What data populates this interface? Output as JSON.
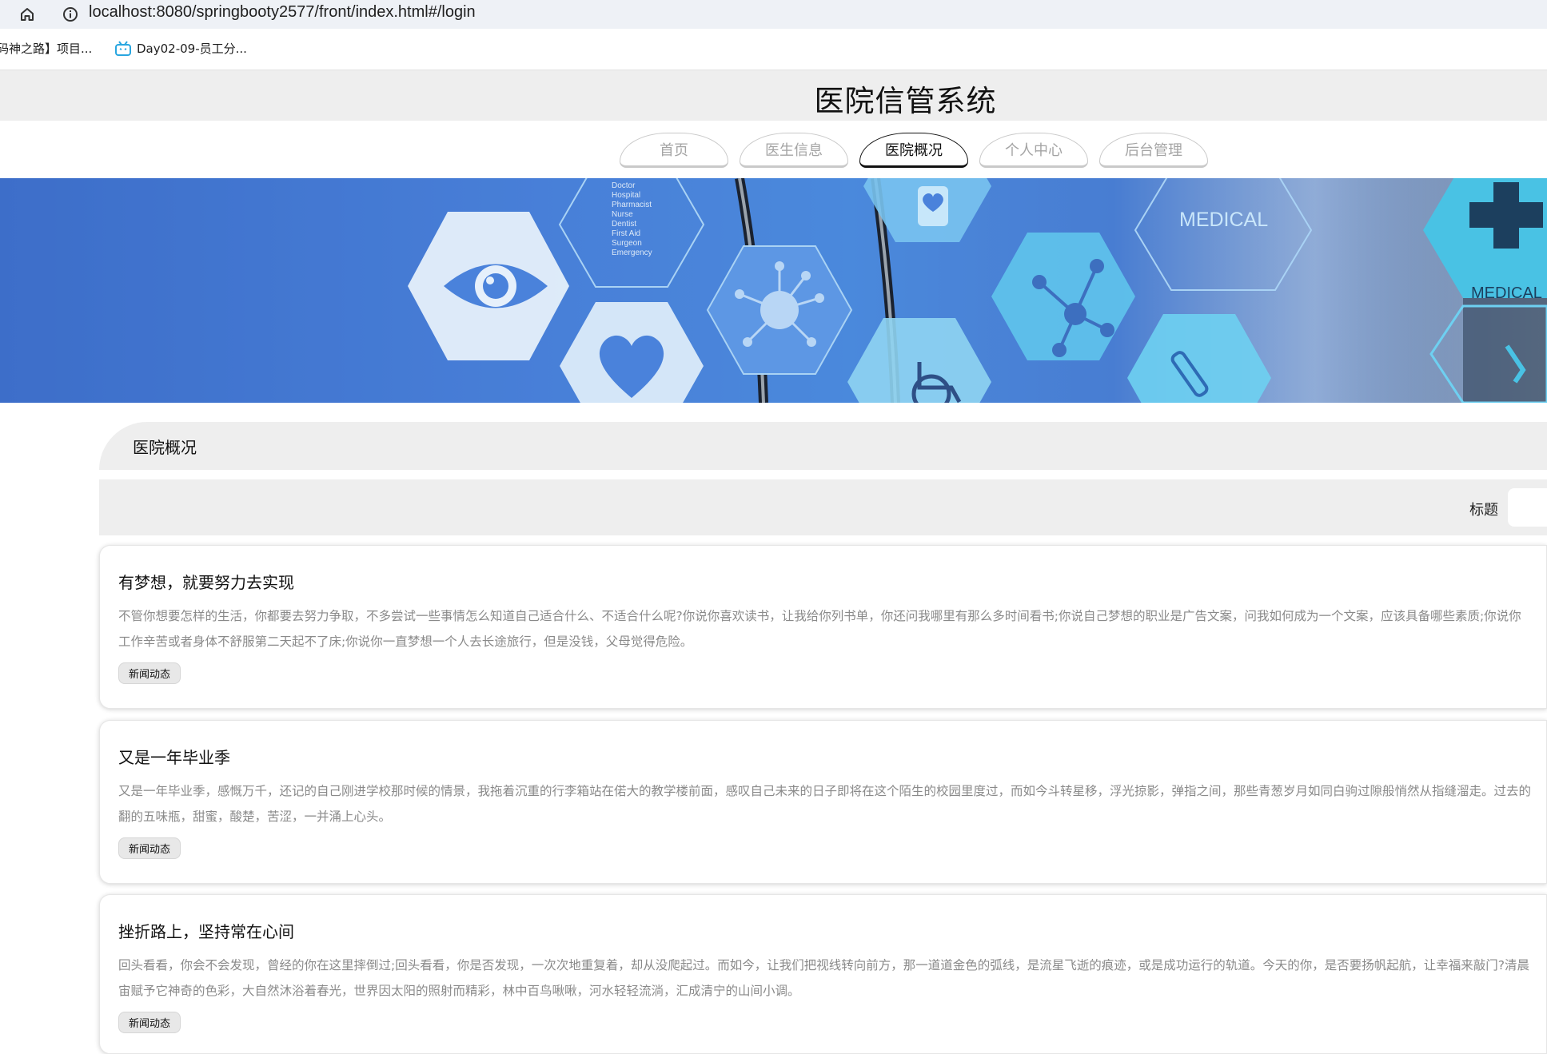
{
  "browser": {
    "url": "localhost:8080/springbooty2577/front/index.html#/login",
    "bookmarks": [
      {
        "label": "码神之路】项目..."
      },
      {
        "label": "Day02-09-员工分..."
      }
    ]
  },
  "site": {
    "title": "医院信管系统"
  },
  "nav": [
    {
      "label": "首页",
      "active": false
    },
    {
      "label": "医生信息",
      "active": false
    },
    {
      "label": "医院概况",
      "active": true
    },
    {
      "label": "个人中心",
      "active": false
    },
    {
      "label": "后台管理",
      "active": false
    }
  ],
  "banner": {
    "texts": [
      "MEDICAL",
      "MEDICAL",
      "Doctor",
      "Hospital",
      "Pharmacist",
      "Nurse",
      "Dentist",
      "First Aid",
      "Surgeon",
      "Emergency"
    ]
  },
  "section": {
    "title": "医院概况"
  },
  "search": {
    "label": "标题",
    "value": ""
  },
  "articles": [
    {
      "title": "有梦想，就要努力去实现",
      "line1": "不管你想要怎样的生活，你都要去努力争取，不多尝试一些事情怎么知道自己适合什么、不适合什么呢?你说你喜欢读书，让我给你列书单，你还问我哪里有那么多时间看书;你说自己梦想的职业是广告文案，问我如何成为一个文案，应该具备哪些素质;你说你",
      "line2": "工作辛苦或者身体不舒服第二天起不了床;你说你一直梦想一个人去长途旅行，但是没钱，父母觉得危险。",
      "tag": "新闻动态"
    },
    {
      "title": "又是一年毕业季",
      "line1": "又是一年毕业季，感慨万千，还记的自己刚进学校那时候的情景，我拖着沉重的行李箱站在偌大的教学楼前面，感叹自己未来的日子即将在这个陌生的校园里度过，而如今斗转星移，浮光掠影，弹指之间，那些青葱岁月如同白驹过隙般悄然从指缝溜走。过去的",
      "line2": "翻的五味瓶，甜蜜，酸楚，苦涩，一并涌上心头。",
      "tag": "新闻动态"
    },
    {
      "title": "挫折路上，坚持常在心间",
      "line1": "回头看看，你会不会发现，曾经的你在这里摔倒过;回头看看，你是否发现，一次次地重复着，却从没爬起过。而如今，让我们把视线转向前方，那一道道金色的弧线，是流星飞逝的痕迹，或是成功运行的轨道。今天的你，是否要扬帆起航，让幸福来敲门?清晨",
      "line2": "宙赋予它神奇的色彩，大自然沐浴着春光，世界因太阳的照射而精彩，林中百鸟啾啾，河水轻轻流淌，汇成清宁的山间小调。",
      "tag": "新闻动态"
    }
  ],
  "colors": {
    "header_bg": "#eeeeee",
    "banner_blue": "#4a82db",
    "hex_light": "#bcd7f3",
    "text_muted": "#8a8a8a"
  }
}
